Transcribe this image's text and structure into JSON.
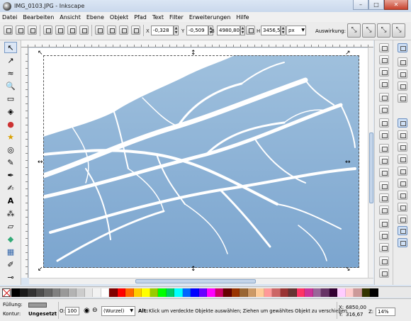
{
  "window": {
    "title": "IMG_0103.JPG - Inkscape",
    "minimize": "–",
    "maximize": "□",
    "close": "✕"
  },
  "menu": [
    "Datei",
    "Bearbeiten",
    "Ansicht",
    "Ebene",
    "Objekt",
    "Pfad",
    "Text",
    "Filter",
    "Erweiterungen",
    "Hilfe"
  ],
  "toolbar": {
    "x_label": "X",
    "x_value": "-0,328",
    "y_label": "Y",
    "y_value": "-0,509",
    "w_label": "B",
    "w_value": "4980,80",
    "h_label": "H",
    "h_value": "3456,53",
    "unit": "px",
    "affect_label": "Auswirkung:"
  },
  "tools": [
    "selector-tool",
    "node-tool",
    "tweak-tool",
    "zoom-tool",
    "rectangle-tool",
    "3d-box-tool",
    "ellipse-tool",
    "star-tool",
    "spiral-tool",
    "pencil-tool",
    "pen-tool",
    "calligraphy-tool",
    "text-tool",
    "spray-tool",
    "eraser-tool",
    "bucket-tool",
    "gradient-tool",
    "dropper-tool",
    "connector-tool"
  ],
  "palette_colors": [
    "#000000",
    "#1a1a1a",
    "#333333",
    "#4d4d4d",
    "#666666",
    "#808080",
    "#999999",
    "#b3b3b3",
    "#cccccc",
    "#e6e6e6",
    "#f2f2f2",
    "#ffffff",
    "#800000",
    "#ff0000",
    "#ff6600",
    "#ffcc00",
    "#ffff00",
    "#99cc00",
    "#00ff00",
    "#00cc66",
    "#00ffff",
    "#0066ff",
    "#0000ff",
    "#6600ff",
    "#ff00ff",
    "#cc0066",
    "#660000",
    "#993300",
    "#996633",
    "#cc9966",
    "#ffcc99",
    "#ff9999",
    "#cc6666",
    "#993333",
    "#663333",
    "#ff3366",
    "#cc3399",
    "#996699",
    "#663366",
    "#330033",
    "#ffccff",
    "#ffcccc",
    "#cc9999",
    "#333300",
    "#000000"
  ],
  "status": {
    "fill_label": "Füllung:",
    "stroke_label": "Kontur:",
    "stroke_value": "Ungesetzt",
    "opacity_label": "O:",
    "opacity_value": "100",
    "layer": "(Wurzel)",
    "message_bold": "Alt:",
    "message": "Klick um verdeckte Objekte auswählen; Ziehen um gewähltes Objekt zu verschieben",
    "x_label": "X:",
    "x_value": "6850,00",
    "y_label": "Y:",
    "y_value": "316,67",
    "zoom_label": "Z:",
    "zoom_value": "14%"
  }
}
